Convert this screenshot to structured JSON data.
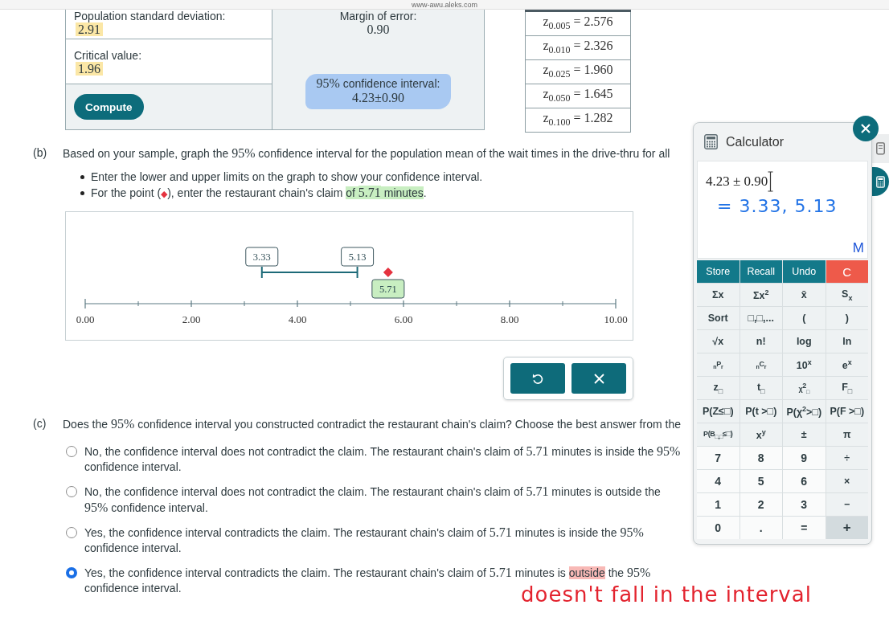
{
  "browser_bar": {
    "url": "www-awu.aleks.com"
  },
  "stats_table": {
    "population_sd": {
      "label": "Population standard deviation:",
      "value": "2.91",
      "color": "#fbe7a6"
    },
    "critical_value": {
      "label": "Critical value:",
      "value": "1.96",
      "color": "#fbe7a6"
    },
    "compute_button": "Compute",
    "margin_of_error": {
      "label": "Margin of error:",
      "value": "0.90"
    },
    "confidence_interval": {
      "label": [
        {
          "text": "95%",
          "kind": "math"
        },
        {
          "text": " confidence interval:",
          "kind": "text"
        }
      ],
      "value": "4.23±0.90",
      "color": "#a9c9f2"
    }
  },
  "z_table": {
    "rows": [
      "z$_{0.005}$ = 2.576",
      "z$_{0.010}$ = 2.326",
      "z$_{0.025}$ = 1.960",
      "z$_{0.050}$ = 1.645",
      "z$_{0.100}$ = 1.282"
    ]
  },
  "part_b": {
    "marker": "(b)",
    "prompt": [
      {
        "text": "Based on your sample, graph the ",
        "kind": "text"
      },
      {
        "text": "95%",
        "kind": "math"
      },
      {
        "text": " confidence interval for the population mean of the wait times in the drive-thru for all",
        "kind": "text"
      }
    ],
    "bullets": [
      [
        {
          "text": "Enter the lower and upper limits on the graph to show your confidence interval.",
          "kind": "text"
        }
      ],
      [
        {
          "text": "For the point (",
          "kind": "text"
        },
        {
          "text": "◆",
          "kind": "symbol"
        },
        {
          "text": "), enter the restaurant chain's claim ",
          "kind": "text"
        },
        {
          "text": "of ",
          "kind": "text",
          "color": "#c8eec1"
        },
        {
          "text": "5.71",
          "kind": "math",
          "color": "#c8eec1"
        },
        {
          "text": " minutes",
          "kind": "text",
          "color": "#c8eec1"
        },
        {
          "text": ".",
          "kind": "text"
        }
      ]
    ],
    "number_line": {
      "tick_labels": [
        "0.00",
        "2.00",
        "4.00",
        "6.00",
        "8.00",
        "10.00"
      ],
      "interval": {
        "lower": "3.33",
        "upper": "5.13"
      },
      "point": {
        "value": "5.71",
        "color": "#c8eec1"
      }
    },
    "buttons": [
      {
        "kind": "undo"
      },
      {
        "kind": "clear"
      }
    ]
  },
  "part_c": {
    "marker": "(c)",
    "question": [
      {
        "text": "Does the ",
        "kind": "text"
      },
      {
        "text": "95%",
        "kind": "math"
      },
      {
        "text": " confidence interval you constructed contradict the restaurant chain's claim? Choose the best answer from the",
        "kind": "text"
      }
    ],
    "options": [
      {
        "selected": false,
        "text": [
          {
            "text": "No, the confidence interval does not contradict the claim. The restaurant chain's claim of ",
            "kind": "text"
          },
          {
            "text": "5.71",
            "kind": "math"
          },
          {
            "text": " minutes is inside the ",
            "kind": "text"
          },
          {
            "text": "95%",
            "kind": "math"
          },
          {
            "text": " confidence interval.",
            "kind": "text"
          }
        ]
      },
      {
        "selected": false,
        "text": [
          {
            "text": "No, the confidence interval does not contradict the claim. The restaurant chain's claim of ",
            "kind": "text"
          },
          {
            "text": "5.71",
            "kind": "math"
          },
          {
            "text": " minutes is outside the ",
            "kind": "text"
          },
          {
            "text": "95%",
            "kind": "math"
          },
          {
            "text": " confidence interval.",
            "kind": "text"
          }
        ]
      },
      {
        "selected": false,
        "text": [
          {
            "text": "Yes, the confidence interval contradicts the claim. The restaurant chain's claim of ",
            "kind": "text"
          },
          {
            "text": "5.71",
            "kind": "math"
          },
          {
            "text": " minutes is inside the ",
            "kind": "text"
          },
          {
            "text": "95%",
            "kind": "math"
          },
          {
            "text": " confidence interval.",
            "kind": "text"
          }
        ]
      },
      {
        "selected": true,
        "text": [
          {
            "text": "Yes, the confidence interval contradicts the claim. The restaurant chain's claim of ",
            "kind": "text"
          },
          {
            "text": "5.71",
            "kind": "math"
          },
          {
            "text": " minutes is ",
            "kind": "text"
          },
          {
            "text": "outside",
            "kind": "text",
            "color": "#f8b9b6"
          },
          {
            "text": " the ",
            "kind": "text"
          },
          {
            "text": "95%",
            "kind": "math"
          },
          {
            "text": " confidence interval.",
            "kind": "text"
          }
        ]
      }
    ]
  },
  "annotation": {
    "text": "doesn't fall in the interval"
  },
  "calculator": {
    "title": "Calculator",
    "expression": "4.23 ± 0.90",
    "handwriting": "= 3.33, 5.13",
    "memory": "M",
    "keys": [
      [
        {
          "label": "Store",
          "kind": "command",
          "pressed": false
        },
        {
          "label": "Recall",
          "kind": "command",
          "pressed": false
        },
        {
          "label": "Undo",
          "kind": "command",
          "pressed": false
        },
        {
          "label": "C",
          "kind": "clear",
          "pressed": false
        }
      ],
      [
        {
          "label": "Σx",
          "kind": "function",
          "pressed": false
        },
        {
          "label": "Σx$^{2}$",
          "kind": "function",
          "pressed": false
        },
        {
          "label": "x̄",
          "kind": "function",
          "pressed": false
        },
        {
          "label": "S$_{x}$",
          "kind": "function",
          "pressed": false
        }
      ],
      [
        {
          "label": "Sort",
          "kind": "function",
          "pressed": false
        },
        {
          "label": "□,□,...",
          "kind": "function",
          "pressed": false
        },
        {
          "label": "(",
          "kind": "function",
          "pressed": false
        },
        {
          "label": ")",
          "kind": "function",
          "pressed": false
        }
      ],
      [
        {
          "label": "√x",
          "kind": "function",
          "pressed": false
        },
        {
          "label": "n!",
          "kind": "function",
          "pressed": false
        },
        {
          "label": "log",
          "kind": "function",
          "pressed": false
        },
        {
          "label": "ln",
          "kind": "function",
          "pressed": false
        }
      ],
      [
        {
          "label": "$_{n}$P$_{r}$",
          "kind": "function",
          "pressed": false
        },
        {
          "label": "$_{n}$C$_{r}$",
          "kind": "function",
          "pressed": false
        },
        {
          "label": "10$^{x}$",
          "kind": "function",
          "pressed": false
        },
        {
          "label": "e$^{x}$",
          "kind": "function",
          "pressed": false
        }
      ],
      [
        {
          "label": "z$_{□}$",
          "kind": "function",
          "pressed": false
        },
        {
          "label": "t$_{□}$",
          "kind": "function",
          "pressed": false
        },
        {
          "label": "χ$^{2}$$_{□}$",
          "kind": "function",
          "pressed": false
        },
        {
          "label": "F$_{□}$",
          "kind": "function",
          "pressed": false
        }
      ],
      [
        {
          "label": "P(Z≤□)",
          "kind": "function",
          "pressed": false
        },
        {
          "label": "P(t >□)",
          "kind": "function",
          "pressed": false
        },
        {
          "label": "P(χ$^{2}$>□)",
          "kind": "function",
          "pressed": false
        },
        {
          "label": "P(F >□)",
          "kind": "function",
          "pressed": false
        }
      ],
      [
        {
          "label": "P(B$_{□,□}$≤□)",
          "kind": "function",
          "pressed": false
        },
        {
          "label": "x$^{y}$",
          "kind": "function",
          "pressed": false
        },
        {
          "label": "±",
          "kind": "function",
          "pressed": false
        },
        {
          "label": "π",
          "kind": "function",
          "pressed": false
        }
      ],
      [
        {
          "label": "7",
          "kind": "digit",
          "pressed": false
        },
        {
          "label": "8",
          "kind": "digit",
          "pressed": false
        },
        {
          "label": "9",
          "kind": "digit",
          "pressed": false
        },
        {
          "label": "÷",
          "kind": "function",
          "pressed": false
        }
      ],
      [
        {
          "label": "4",
          "kind": "digit",
          "pressed": false
        },
        {
          "label": "5",
          "kind": "digit",
          "pressed": false
        },
        {
          "label": "6",
          "kind": "digit",
          "pressed": false
        },
        {
          "label": "×",
          "kind": "function",
          "pressed": false
        }
      ],
      [
        {
          "label": "1",
          "kind": "digit",
          "pressed": false
        },
        {
          "label": "2",
          "kind": "digit",
          "pressed": false
        },
        {
          "label": "3",
          "kind": "digit",
          "pressed": false
        },
        {
          "label": "−",
          "kind": "function",
          "pressed": false
        }
      ],
      [
        {
          "label": "0",
          "kind": "digit",
          "pressed": false
        },
        {
          "label": ".",
          "kind": "digit",
          "pressed": false
        },
        {
          "label": "=",
          "kind": "digit",
          "pressed": false
        },
        {
          "label": "+",
          "kind": "function",
          "pressed": true
        }
      ]
    ]
  },
  "side_buttons": [
    {
      "kind": "document"
    },
    {
      "kind": "calculator"
    }
  ]
}
